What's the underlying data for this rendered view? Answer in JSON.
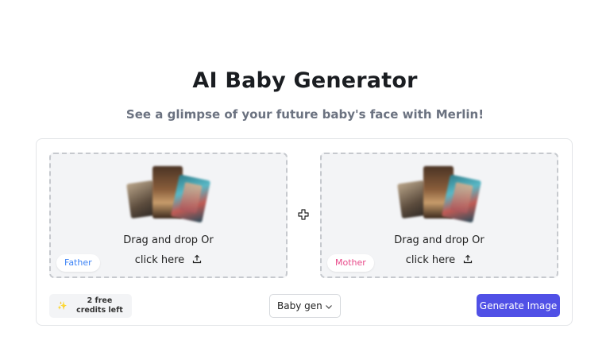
{
  "header": {
    "title": "AI Baby Generator",
    "subtitle": "See a glimpse of your future baby's face with Merlin!"
  },
  "uploads": {
    "father": {
      "line1": "Drag and drop Or",
      "line2": "click here",
      "tag": "Father"
    },
    "mother": {
      "line1": "Drag and drop Or",
      "line2": "click here",
      "tag": "Mother"
    }
  },
  "footer": {
    "credits_label": "2 free credits left",
    "gender_select_value": "Baby gender",
    "generate_label": "Generate Image"
  },
  "colors": {
    "accent": "#5050e6",
    "father_tag": "#3b82f6",
    "mother_tag": "#e84a8a"
  },
  "icons": [
    "sample-photos-collage",
    "upload-icon",
    "plus-icon",
    "sparkle-icon",
    "chevron-down-icon"
  ]
}
